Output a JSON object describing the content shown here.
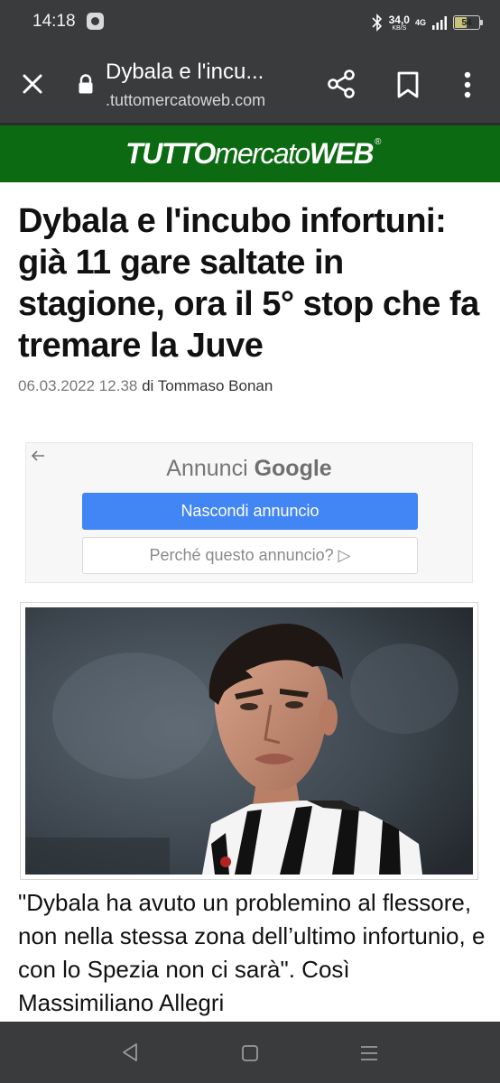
{
  "status_bar": {
    "time": "14:18",
    "net_speed_value": "34,0",
    "net_speed_unit": "KB/S",
    "network": "4G",
    "battery": "54",
    "icons": [
      "settings-icon",
      "bluetooth-icon",
      "signal-icon",
      "battery-icon"
    ]
  },
  "browser": {
    "tab_title": "Dybala e l'incu...",
    "url": ".tuttomercatoweb.com",
    "icons": [
      "close-icon",
      "lock-icon",
      "share-icon",
      "bookmark-icon",
      "more-vert-icon"
    ]
  },
  "site": {
    "logo_bold": "TUTTO",
    "logo_mid": "mercato",
    "logo_end": "WEB",
    "logo_reg": "®",
    "header_color": "#0c6b12"
  },
  "article": {
    "headline": "Dybala e l'incubo infortuni: già 11 gare saltate in stagione, ora il 5° stop che fa tremare la Juve",
    "date": "06.03.2022 12.38",
    "author": "di Tommaso Bonan",
    "body": "\"Dybala ha avuto un problemino al flessore, non nella stessa zona dell’ultimo infortunio, e con lo Spezia non ci sarà\". Così Massimiliano Allegri"
  },
  "ad": {
    "title_prefix": "Annunci",
    "title_brand": "Google",
    "hide_label": "Nascondi annuncio",
    "why_label": "Perché questo annuncio? ▷",
    "accent": "#4285f4"
  },
  "nav": {
    "icons": [
      "nav-back-icon",
      "nav-home-icon",
      "nav-recents-icon"
    ]
  }
}
